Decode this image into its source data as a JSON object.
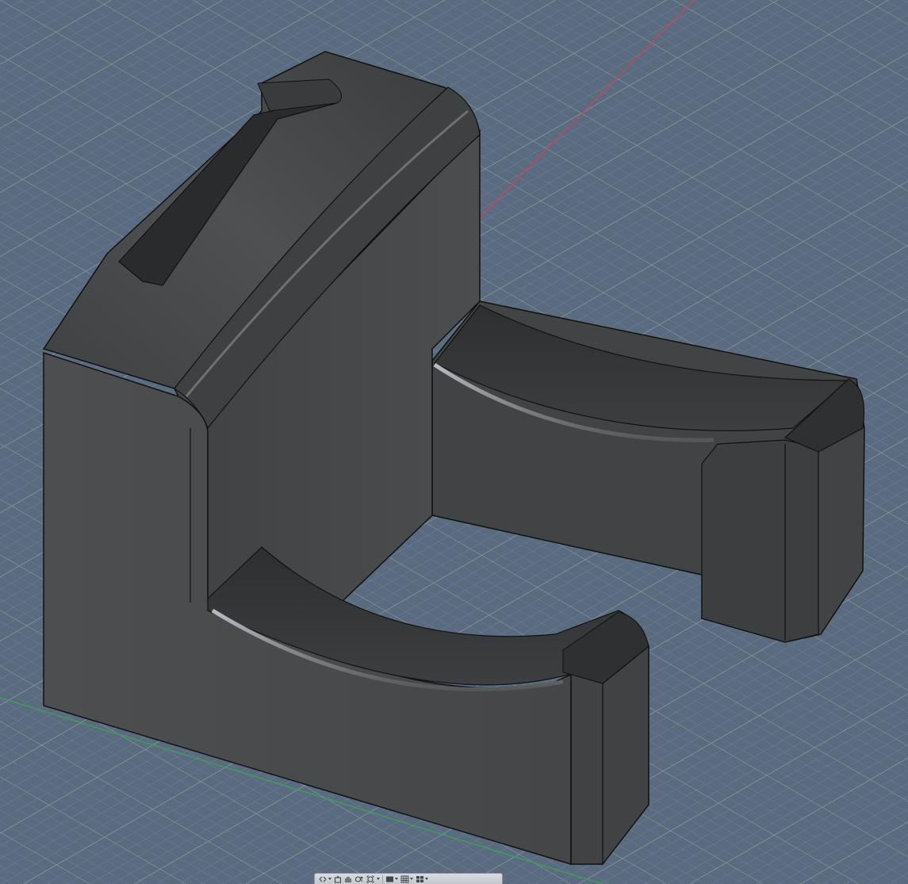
{
  "app": {
    "view": "3d-viewport",
    "theme": {
      "background": "#5b6b7f",
      "grid_minor": "#7a899b",
      "grid_major": "#8e9cad",
      "axis_x": "#c4475a",
      "axis_y": "#3f9e5a",
      "model_body": "#4a4a4c",
      "model_dark": "#2f3031",
      "model_edge": "#111213",
      "toolbar_bg": "#cfd3d8"
    }
  },
  "navigation_bar": {
    "tools": [
      {
        "name": "orbit",
        "icon": "orbit-icon"
      },
      {
        "name": "look-at",
        "icon": "look-at-icon"
      },
      {
        "name": "pan",
        "icon": "pan-icon"
      },
      {
        "name": "zoom",
        "icon": "zoom-icon"
      },
      {
        "name": "fit",
        "icon": "fit-icon"
      },
      {
        "name": "display-settings",
        "icon": "display-settings-icon"
      },
      {
        "name": "grid-snaps",
        "icon": "grid-icon"
      },
      {
        "name": "viewports",
        "icon": "viewports-icon"
      }
    ]
  }
}
